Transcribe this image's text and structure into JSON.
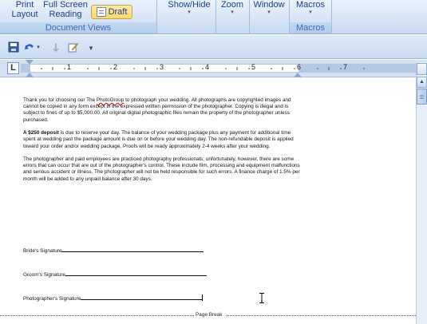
{
  "ribbon": {
    "print_layout": [
      "Print",
      "Layout"
    ],
    "full_screen_reading": [
      "Full Screen",
      "Reading"
    ],
    "draft": "Draft",
    "document_views_label": "Document Views",
    "show_hide": "Show/Hide",
    "zoom": "Zoom",
    "window": "Window",
    "macros": "Macros",
    "macros_label": "Macros"
  },
  "ruler": {
    "numbers": [
      "1",
      "2",
      "3",
      "4",
      "5",
      "6",
      "7"
    ]
  },
  "document": {
    "p1": {
      "a": "Thank you for choosing our The ",
      "misspelled": "PhotoGroup",
      "b": " to photograph your wedding. All photographs are copyrighted images and cannot be copied in any form except in the expressed written permission of the photographer. Copying is illegal and is subject to fines of up to $5,000.00. All original digital photographic files remain the property of the photographer unless purchased."
    },
    "p2": {
      "bold": "A $250 deposit",
      "rest": " is due to reserve your day. The balance of your wedding package plus any payment for additional time spent at wedding past the package amount is due on or before your wedding day. The non-refundable deposit is applied toward your order and/or wedding package. Proofs will be ready approximately 2-4 weeks after your wedding."
    },
    "p3": "The photographer and paid employees are practiced photography professionals; unfortunately, however, there are some errors that can occur that are out of the photographer's control. These include film, processing and equipment malfunctions and serious accident or illness. The photographer will not be held responsible for such errors. A finance charge of 1.5% per month will be added to any unpaid balance after 30 days.",
    "signatures": {
      "bride": "Bride's Signature",
      "groom": "Groom's Signature",
      "photographer": "Photographer's Signature"
    },
    "page_break": "Page Break"
  },
  "colors": {
    "ribbon_text": "#15428b",
    "group_label": "#3e6aaa",
    "active_button": "#ffd767"
  }
}
